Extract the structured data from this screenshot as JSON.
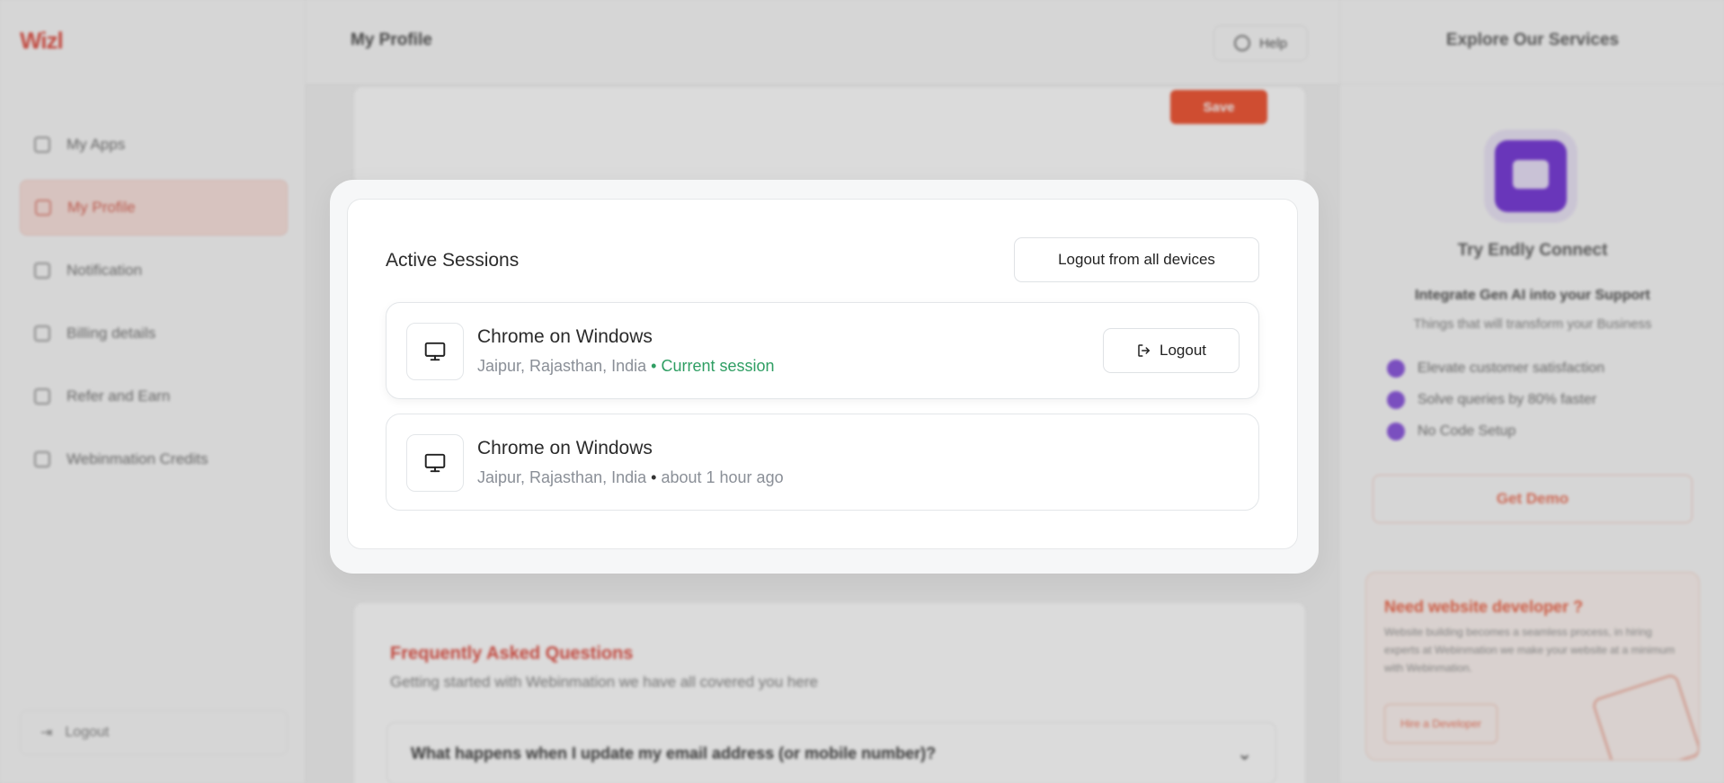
{
  "app": {
    "logo": "Wizl",
    "logo_sub": ""
  },
  "sidebar": {
    "items": [
      {
        "label": "My Apps",
        "icon": "apps-icon"
      },
      {
        "label": "My Profile",
        "icon": "user-icon",
        "active": true
      },
      {
        "label": "Notification",
        "icon": "bell-icon"
      },
      {
        "label": "Billing details",
        "icon": "billing-icon"
      },
      {
        "label": "Refer and Earn",
        "icon": "gift-icon"
      },
      {
        "label": "Webinmation Credits",
        "icon": "credits-icon"
      }
    ],
    "logout_label": "Logout"
  },
  "header": {
    "title": "My Profile",
    "help_label": "Help"
  },
  "profile_card": {
    "save_label": "Save"
  },
  "faq": {
    "title": "Frequently Asked Questions",
    "subtitle": "Getting started with Webinmation we have all covered you here",
    "question": "What happens when I update my email address (or mobile number)?"
  },
  "rightbar": {
    "title": "Explore Our Services",
    "promo_name": "Try Endly Connect",
    "promo_tagline": "Integrate Gen AI into your Support",
    "promo_tagline2": "Things that will transform your Business",
    "features": [
      "Elevate customer satisfaction",
      "Solve queries by 80% faster",
      "No Code Setup"
    ],
    "demo_label": "Get Demo",
    "dev_title": "Need website developer ?",
    "dev_text": "Website building becomes a seamless process, in hiring experts at Webinmation we make your website at a minimum with Webinmation.",
    "dev_button": "Hire a Developer"
  },
  "modal": {
    "title": "Active Sessions",
    "logout_all_label": "Logout from all devices",
    "sessions": [
      {
        "device": "Chrome on Windows",
        "location": "Jaipur, Rajasthan, India",
        "separator": "•",
        "status": "Current session",
        "logout_label": "Logout"
      },
      {
        "device": "Chrome on Windows",
        "location": "Jaipur, Rajasthan, India",
        "separator": "•",
        "status": "about 1 hour ago"
      }
    ]
  },
  "colors": {
    "accent": "#f15a3a",
    "current_session": "#2f9e63",
    "purple": "#7b3fd9"
  }
}
